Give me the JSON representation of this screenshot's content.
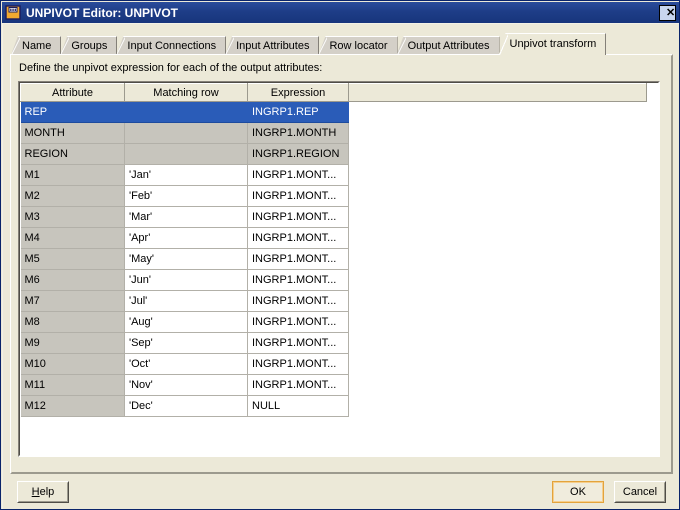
{
  "window": {
    "title": "UNPIVOT Editor: UNPIVOT",
    "icon": "app-window-icon",
    "close_label": "✕",
    "accent_titlebar": "#1e3d87",
    "accent_selection": "#2a5cb8",
    "accent_default_button": "#e3a33c"
  },
  "tabs": [
    {
      "label": "Name",
      "active": false
    },
    {
      "label": "Groups",
      "active": false
    },
    {
      "label": "Input Connections",
      "active": false
    },
    {
      "label": "Input Attributes",
      "active": false
    },
    {
      "label": "Row locator",
      "active": false
    },
    {
      "label": "Output Attributes",
      "active": false
    },
    {
      "label": "Unpivot transform",
      "active": true
    }
  ],
  "panel": {
    "instruction": "Define the unpivot expression for each of the output attributes:"
  },
  "table": {
    "columns": [
      {
        "key": "attribute",
        "label": "Attribute"
      },
      {
        "key": "matching_row",
        "label": "Matching row"
      },
      {
        "key": "expression",
        "label": "Expression"
      }
    ],
    "rows": [
      {
        "attribute": "REP",
        "matching_row": "",
        "expression": "INGRP1.REP",
        "state": "selected"
      },
      {
        "attribute": "MONTH",
        "matching_row": "",
        "expression": "INGRP1.MONTH",
        "state": "readonly"
      },
      {
        "attribute": "REGION",
        "matching_row": "",
        "expression": "INGRP1.REGION",
        "state": "readonly"
      },
      {
        "attribute": "M1",
        "matching_row": "'Jan'",
        "expression": "INGRP1.MONT...",
        "state": "normal"
      },
      {
        "attribute": "M2",
        "matching_row": "'Feb'",
        "expression": "INGRP1.MONT...",
        "state": "normal"
      },
      {
        "attribute": "M3",
        "matching_row": "'Mar'",
        "expression": "INGRP1.MONT...",
        "state": "normal"
      },
      {
        "attribute": "M4",
        "matching_row": "'Apr'",
        "expression": "INGRP1.MONT...",
        "state": "normal"
      },
      {
        "attribute": "M5",
        "matching_row": "'May'",
        "expression": "INGRP1.MONT...",
        "state": "normal"
      },
      {
        "attribute": "M6",
        "matching_row": "'Jun'",
        "expression": "INGRP1.MONT...",
        "state": "normal"
      },
      {
        "attribute": "M7",
        "matching_row": "'Jul'",
        "expression": "INGRP1.MONT...",
        "state": "normal"
      },
      {
        "attribute": "M8",
        "matching_row": "'Aug'",
        "expression": "INGRP1.MONT...",
        "state": "normal"
      },
      {
        "attribute": "M9",
        "matching_row": "'Sep'",
        "expression": "INGRP1.MONT...",
        "state": "normal"
      },
      {
        "attribute": "M10",
        "matching_row": "'Oct'",
        "expression": "INGRP1.MONT...",
        "state": "normal"
      },
      {
        "attribute": "M11",
        "matching_row": "'Nov'",
        "expression": "INGRP1.MONT...",
        "state": "normal"
      },
      {
        "attribute": "M12",
        "matching_row": "'Dec'",
        "expression": "NULL",
        "state": "normal"
      }
    ]
  },
  "buttons": {
    "help": {
      "label": "Help",
      "mnemonic": "H"
    },
    "ok": {
      "label": "OK",
      "default": true
    },
    "cancel": {
      "label": "Cancel",
      "default": false
    }
  }
}
